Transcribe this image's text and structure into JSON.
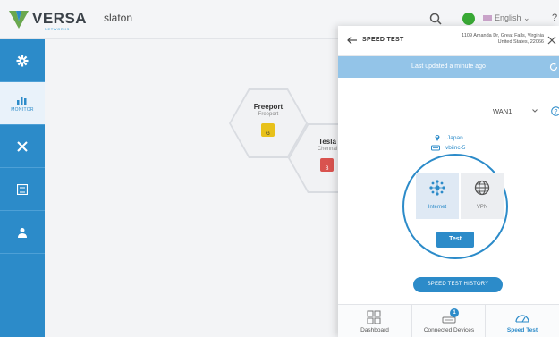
{
  "header": {
    "logo_text": "VERSA",
    "logo_sub": "NETWORKS",
    "tenant": "slaton",
    "language": "English",
    "help": "?"
  },
  "sidebar": {
    "items": [
      {
        "icon": "gear-icon",
        "label": ""
      },
      {
        "icon": "monitor-chart-icon",
        "label": "MONITOR",
        "active": true
      },
      {
        "icon": "tools-icon",
        "label": ""
      },
      {
        "icon": "list-icon",
        "label": ""
      },
      {
        "icon": "user-icon",
        "label": ""
      }
    ]
  },
  "sites": [
    {
      "name": "Freeport",
      "location": "Freeport",
      "icon_color": "#e8c11a",
      "icon_letter": "G"
    },
    {
      "name": "Tesla",
      "location": "Chennai",
      "icon_color": "#d9534f",
      "icon_letter": "B"
    }
  ],
  "panel": {
    "title": "SPEED TEST",
    "address_line1": "1109 Amanda Dr, Great Falls, Virginia",
    "address_line2": "United States, 22066",
    "updated": "Last updated a minute ago",
    "wan_value": "WAN1",
    "location": "Japan",
    "device": "vbiinc-5",
    "options": [
      {
        "label": "Internet",
        "icon": "internet-node-icon",
        "selected": true
      },
      {
        "label": "VPN",
        "icon": "globe-icon",
        "selected": false
      }
    ],
    "test_label": "Test",
    "history_label": "SPEED TEST HISTORY"
  },
  "bottom_nav": [
    {
      "label": "Dashboard",
      "icon": "dashboard-grid-icon",
      "active": false
    },
    {
      "label": "Connected Devices",
      "icon": "devices-icon",
      "active": false,
      "badge": "1"
    },
    {
      "label": "Speed Test",
      "icon": "speedometer-icon",
      "active": true
    }
  ],
  "colors": {
    "accent": "#2c8bc9",
    "sidebar": "#2c8bc9",
    "status_green": "#39a935",
    "updated_bar": "#93c4e8"
  }
}
